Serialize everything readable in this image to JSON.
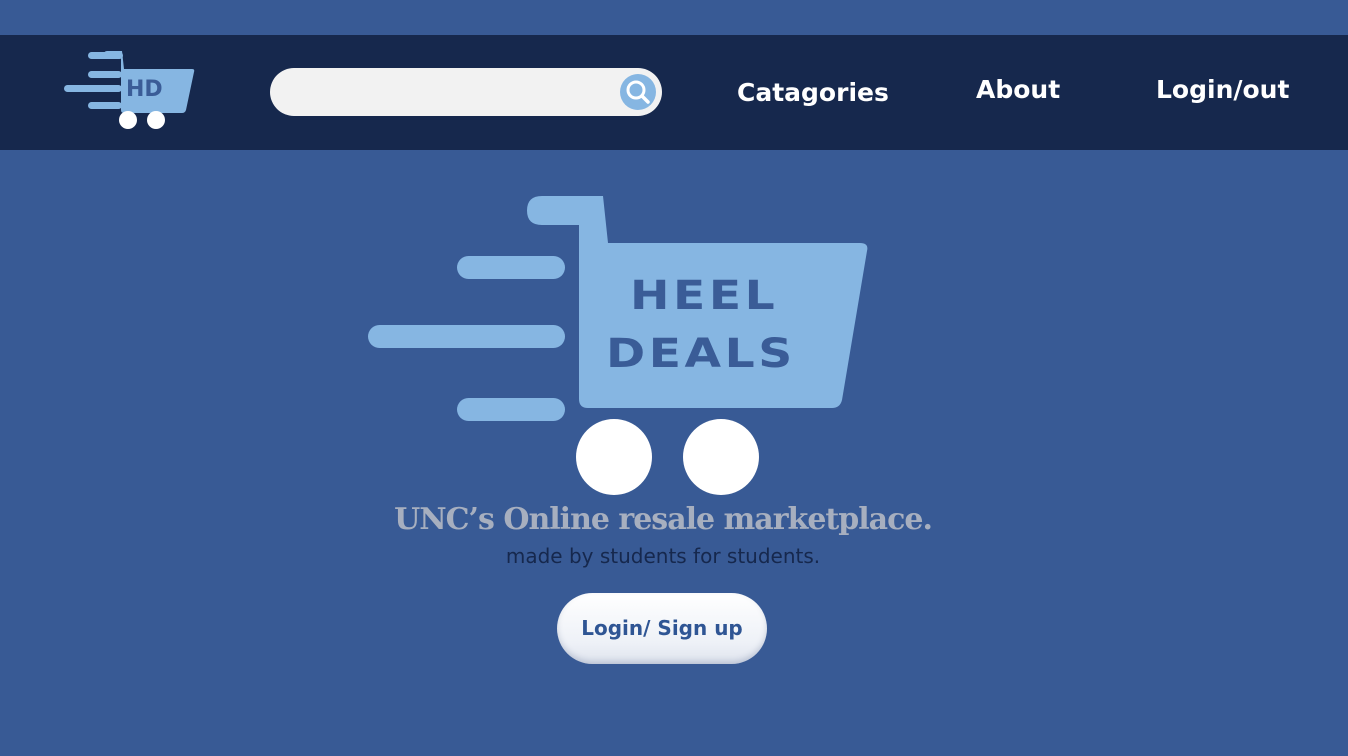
{
  "header": {
    "logo_text": "HD",
    "search": {
      "value": "",
      "placeholder": ""
    },
    "nav": {
      "categories": "Catagories",
      "about": "About",
      "login": "Login/out"
    }
  },
  "hero": {
    "logo_line_1": "HEEL",
    "logo_line_2": "DEALS",
    "tagline": "UNC’s Online resale marketplace.",
    "subtagline": "made by students for students.",
    "cta_label": "Login/ Sign up"
  },
  "icons": {
    "nav_logo": "shopping-cart-logo-icon",
    "search": "search-icon",
    "hero_logo": "shopping-cart-logo-icon"
  },
  "colors": {
    "page_background": "#385a95",
    "navbar_background": "#16284d",
    "accent_light_blue": "#86b6e2",
    "logo_text": "#3a5c97",
    "tagline": "#a7afbf",
    "subtagline": "#16284d",
    "button_background": "#f4f6fa",
    "button_text": "#2f5594",
    "white": "#ffffff"
  }
}
